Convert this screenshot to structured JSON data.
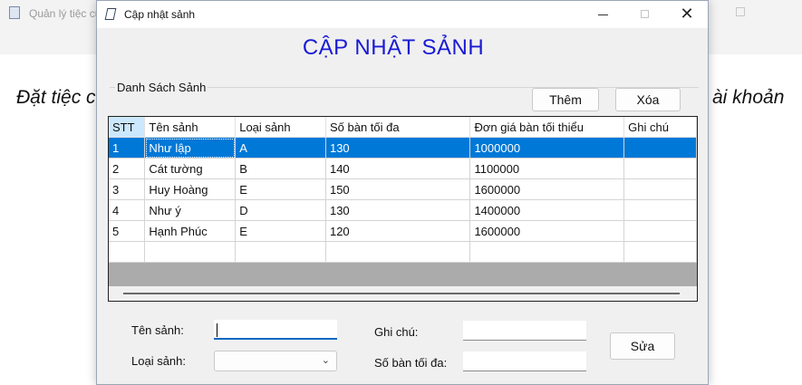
{
  "background_window": {
    "title": "Quản lý tiệc cư",
    "menu_left": "Đặt tiệc c",
    "menu_right": "ài khoản"
  },
  "dialog": {
    "title": "Cập nhật sảnh",
    "heading": "CẬP NHẬT SẢNH",
    "group_label": "Danh Sách Sảnh",
    "buttons": {
      "add": "Thêm",
      "delete": "Xóa",
      "edit": "Sửa"
    },
    "window_controls": {
      "close": "✕"
    }
  },
  "table": {
    "columns": [
      "STT",
      "Tên sảnh",
      "Loại sảnh",
      "Số bàn tối đa",
      "Đơn giá bàn tối thiểu",
      "Ghi chú"
    ],
    "rows": [
      [
        "1",
        "Như lập",
        "A",
        "130",
        "1000000",
        ""
      ],
      [
        "2",
        "Cát tường",
        "B",
        "140",
        "1100000",
        ""
      ],
      [
        "3",
        "Huy Hoàng",
        "E",
        "150",
        "1600000",
        ""
      ],
      [
        "4",
        "Như ý",
        "D",
        "130",
        "1400000",
        ""
      ],
      [
        "5",
        "Hạnh Phúc",
        "E",
        "120",
        "1600000",
        ""
      ]
    ],
    "selected_row": 0
  },
  "form": {
    "ten_sanh_label": "Tên sảnh:",
    "ten_sanh_value": "",
    "loai_sanh_label": "Loại sảnh:",
    "loai_sanh_value": "",
    "ghi_chu_label": "Ghi chú:",
    "ghi_chu_value": "",
    "so_ban_label": "Số bàn tối đa:",
    "so_ban_value": ""
  },
  "colors": {
    "heading": "#1a1ad6",
    "selection": "#0078d7",
    "header_selected": "#cce8ff"
  },
  "icons": {
    "app": "document-icon",
    "combo": "chevron-down-icon"
  }
}
